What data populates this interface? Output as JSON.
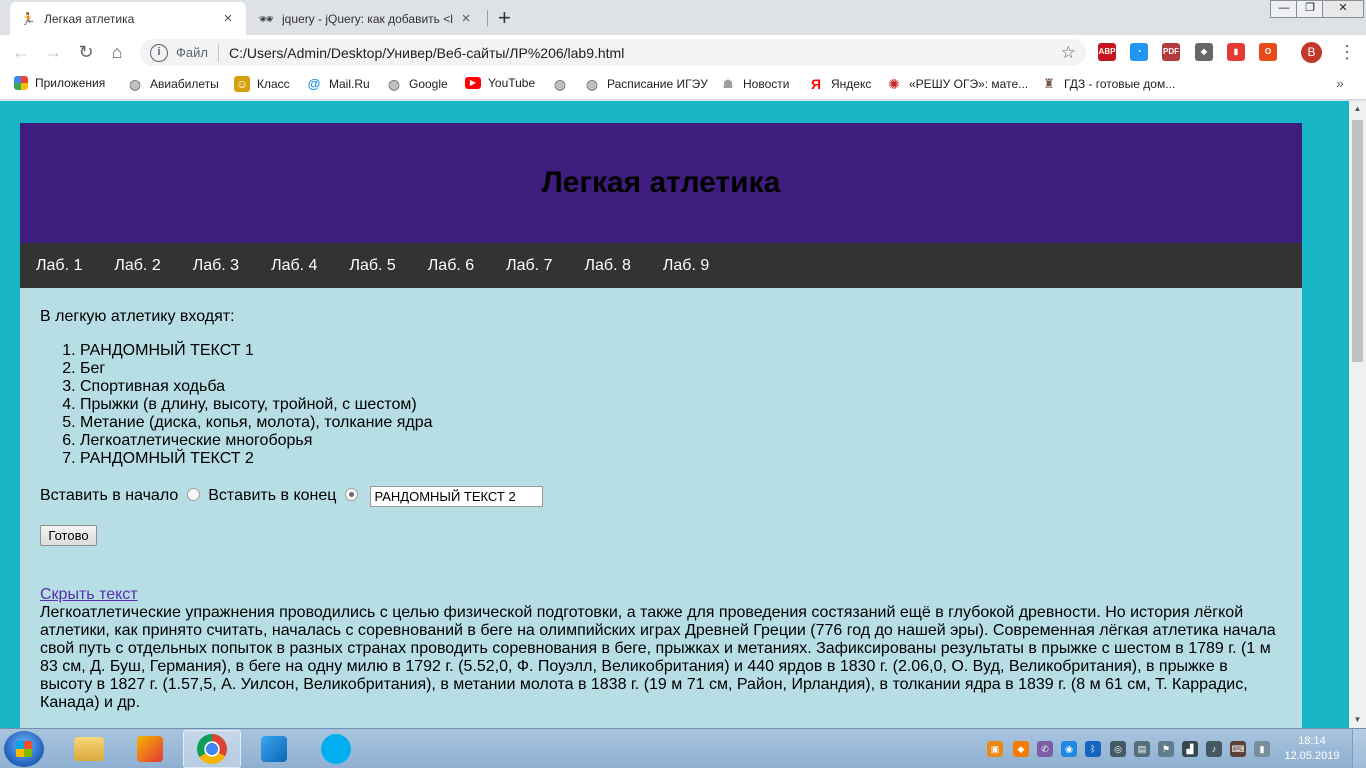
{
  "browser": {
    "tabs": [
      {
        "title": "Легкая атлетика",
        "icon": "runner-icon",
        "active": true
      },
      {
        "title": "jquery - jQuery: как добавить <l",
        "icon": "sunglasses-icon",
        "active": false
      }
    ],
    "new_tab_label": "+",
    "window_controls": {
      "minimize": "—",
      "maximize": "❐",
      "close": "✕"
    },
    "address": {
      "label": "Файл",
      "url": "C:/Users/Admin/Desktop/Универ/Веб-сайты/ЛР%206/lab9.html"
    },
    "profile_initial": "В",
    "extensions": [
      {
        "name": "adblock-icon",
        "text": "ABP",
        "color": "#c4161c"
      },
      {
        "name": "extension-chart-icon",
        "text": "◔",
        "color": "#2196f3"
      },
      {
        "name": "pdf-icon",
        "text": "PDF",
        "color": "#b33a3a"
      },
      {
        "name": "extension-shield-icon",
        "text": "◈",
        "color": "#666666"
      },
      {
        "name": "extension-bookmark-icon",
        "text": "▮",
        "color": "#e53935"
      },
      {
        "name": "office-icon",
        "text": "O",
        "color": "#e64a19"
      }
    ]
  },
  "bookmarks": [
    {
      "label": "Приложения",
      "icon": "apps-icon",
      "color": "#4285f4"
    },
    {
      "label": "Авиабилеты",
      "icon": "globe-icon",
      "color": "#5f6368"
    },
    {
      "label": "Класс",
      "icon": "odnoklassniki-icon",
      "color": "#d7a10e"
    },
    {
      "label": "Mail.Ru",
      "icon": "mailru-icon",
      "color": "#168de2"
    },
    {
      "label": "Google",
      "icon": "globe-icon",
      "color": "#5f6368"
    },
    {
      "label": "YouTube",
      "icon": "youtube-icon",
      "color": "#ff0000"
    },
    {
      "label": "",
      "icon": "globe-icon",
      "color": "#5f6368"
    },
    {
      "label": "Расписание ИГЭУ",
      "icon": "globe-icon",
      "color": "#5f6368"
    },
    {
      "label": "Новости",
      "icon": "news-icon",
      "color": "#9e9e9e"
    },
    {
      "label": "Яндекс",
      "icon": "yandex-icon",
      "color": "#ff0000"
    },
    {
      "label": "«РЕШУ ОГЭ»: мате...",
      "icon": "reshu-oge-icon",
      "color": "#c62828"
    },
    {
      "label": "ГДЗ - готовые дом...",
      "icon": "gdz-icon",
      "color": "#795548"
    }
  ],
  "page": {
    "title": "Легкая атлетика",
    "nav": [
      "Лаб. 1",
      "Лаб. 2",
      "Лаб. 3",
      "Лаб. 4",
      "Лаб. 5",
      "Лаб. 6",
      "Лаб. 7",
      "Лаб. 8",
      "Лаб. 9"
    ],
    "intro": "В легкую атлетику входят:",
    "list_items": [
      "РАНДОМНЫЙ ТЕКСТ 1",
      "Бег",
      "Спортивная ходьба",
      "Прыжки (в длину, высоту, тройной, с шестом)",
      "Метание (диска, копья, молота), толкание ядра",
      "Легкоатлетические многоборья",
      "РАНДОМНЫЙ ТЕКСТ 2"
    ],
    "insert_start_label": "Вставить в начало",
    "insert_end_label": "Вставить в конец",
    "selected_option": "end",
    "input_value": "РАНДОМНЫЙ ТЕКСТ 2",
    "done_label": "Готово",
    "toggle_label": "Скрыть текст",
    "history_text": "Легкоатлетические упражнения проводились с целью физической подготовки, а также для проведения состязаний ещё в глубокой древности. Но история лёгкой атлетики, как принято считать, началась с соревнований в беге на олимпийских играх Древней Греции (776 год до нашей эры). Современная лёгкая атлетика начала свой путь с отдельных попыток в разных странах проводить соревнования в беге, прыжках и метаниях. Зафиксированы результаты в прыжке с шестом в 1789 г. (1 м 83 см, Д. Буш, Германия), в беге на одну милю в 1792 г. (5.52,0, Ф. Поуэлл, Великобритания) и 440 ярдов в 1830 г. (2.06,0, О. Вуд, Великобритания), в прыжке в высоту в 1827 г. (1.57,5, А. Уилсон, Великобритания), в метании молота в 1838 г. (19 м 71 см, Район, Ирландия), в толкании ядра в 1839 г. (8 м 61 см, Т. Каррадис, Канада) и др.",
    "colors": {
      "header": "#3f1d7e",
      "nav": "#333333",
      "body": "#b7dde5",
      "outer": "#17b5c5",
      "link": "#5a2fb0"
    }
  },
  "taskbar": {
    "apps": [
      {
        "name": "explorer-icon",
        "active": false
      },
      {
        "name": "paint-icon",
        "active": false
      },
      {
        "name": "chrome-icon",
        "active": true
      },
      {
        "name": "vscode-icon",
        "active": false
      },
      {
        "name": "skype-icon",
        "active": false
      }
    ],
    "clock_time": "18:14",
    "clock_date": "12.05.2019"
  }
}
